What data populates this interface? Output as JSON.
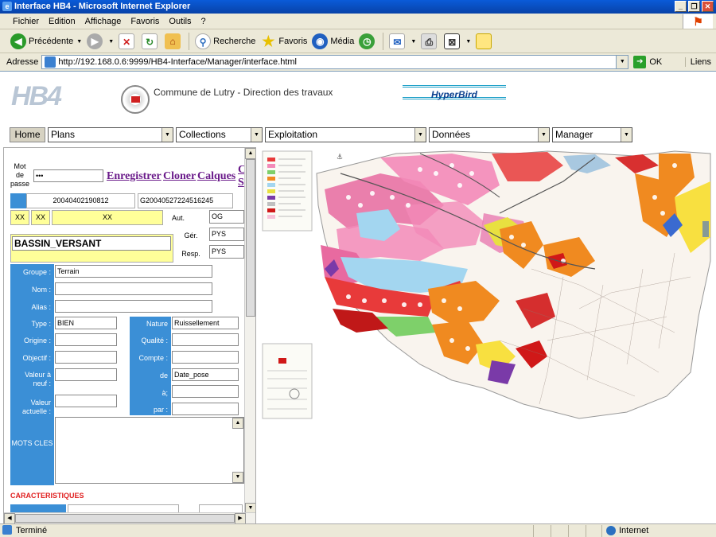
{
  "window": {
    "title": "Interface HB4 - Microsoft Internet Explorer"
  },
  "menu": [
    "Fichier",
    "Edition",
    "Affichage",
    "Favoris",
    "Outils",
    "?"
  ],
  "toolbar": {
    "back": "Précédente",
    "search": "Recherche",
    "favorites": "Favoris",
    "media": "Média"
  },
  "address": {
    "label": "Adresse",
    "url": "http://192.168.0.6:9999/HB4-Interface/Manager/interface.html",
    "go": "OK",
    "links": "Liens"
  },
  "header": {
    "logo": "HB4",
    "commune": "Commune de Lutry - Direction des travaux",
    "brand": "HyperBird"
  },
  "nav": {
    "home": "Home",
    "menus": [
      "Plans",
      "Collections",
      "Exploitation",
      "Données",
      "Manager"
    ]
  },
  "form": {
    "password_label": "Mot de passe",
    "password_value": "•••",
    "actions": [
      "Enregistrer",
      "Cloner",
      "Calques",
      "C",
      "S"
    ],
    "id1": "20040402190812",
    "id2": "G20040527224516245",
    "xx1": "XX",
    "xx2": "XX",
    "xx3": "XX",
    "aut_label": "Aut.",
    "aut_value": "OG",
    "title": "BASSIN_VERSANT",
    "ger_label": "Gér.",
    "ger_value": "PYS",
    "resp_label": "Resp.",
    "resp_value": "PYS",
    "groupe_label": "Groupe :",
    "groupe_value": "Terrain",
    "nom_label": "Nom :",
    "alias_label": "Alias :",
    "type_label": "Type :",
    "type_value": "BIEN",
    "nature_label": "Nature",
    "nature_value": "Ruissellement",
    "origine_label": "Origine :",
    "qualite_label": "Qualité :",
    "objectif_label": "Objectif :",
    "compte_label": "Compte :",
    "valeur_neuf_label": "Valeur à neuf :",
    "de_label": "de",
    "de_value": "Date_pose",
    "a_label": "à;",
    "valeur_actuelle_label": "Valeur actuelle :",
    "par_label": "par :",
    "mots_cles_label": "MOTS CLES",
    "caracteristiques": "CARACTERISTIQUES"
  },
  "status": {
    "left": "Terminé",
    "zone": "Internet"
  }
}
